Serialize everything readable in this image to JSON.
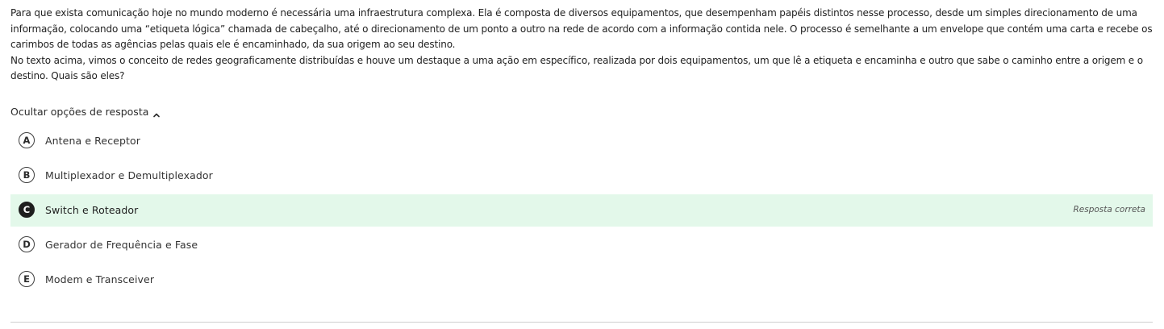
{
  "question": {
    "paragraphs": [
      "Para que exista comunicação hoje no mundo moderno é necessária uma infraestrutura complexa. Ela é composta de diversos equipamentos, que desempenham papéis distintos nesse processo, desde um simples direcionamento de uma informação, colocando uma “etiqueta lógica” chamada de cabeçalho, até o direcionamento de um ponto a outro na rede de acordo com a informação contida nele. O processo é semelhante a um envelope que contém uma carta e recebe os carimbos de todas as agências pelas quais ele é encaminhado, da sua origem ao seu destino.",
      "No texto acima, vimos o conceito de redes geograficamente distribuídas e houve um destaque a uma ação em específico, realizada por dois equipamentos, um que lê a etiqueta e encaminha e outro que sabe o caminho entre a origem e o destino. Quais são eles?"
    ]
  },
  "toggle": {
    "label": "Ocultar opções de resposta",
    "icon": "chevron-up-icon"
  },
  "options": [
    {
      "letter": "A",
      "text": "Antena e Receptor"
    },
    {
      "letter": "B",
      "text": "Multiplexador e Demultiplexador"
    },
    {
      "letter": "C",
      "text": "Switch e Roteador",
      "feedback": "Resposta correta"
    },
    {
      "letter": "D",
      "text": "Gerador de Frequência e Fase"
    },
    {
      "letter": "E",
      "text": "Modem e Transceiver"
    }
  ],
  "colors": {
    "correct_background": "#e3f8ea",
    "selected_marker": "#1e1e1e"
  }
}
